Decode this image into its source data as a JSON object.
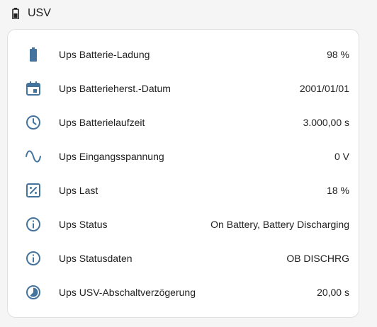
{
  "header": {
    "title": "USV",
    "icon": "battery-icon"
  },
  "accent_color": "#44739e",
  "rows": [
    {
      "label": "Ups Batterie-Ladung",
      "value": "98 %",
      "icon": "battery-full-icon"
    },
    {
      "label": "Ups Batterieherst.-Datum",
      "value": "2001/01/01",
      "icon": "calendar-icon"
    },
    {
      "label": "Ups Batterielaufzeit",
      "value": "3.000,00 s",
      "icon": "clock-icon"
    },
    {
      "label": "Ups Eingangsspannung",
      "value": "0 V",
      "icon": "sine-wave-icon"
    },
    {
      "label": "Ups Last",
      "value": "18 %",
      "icon": "percent-box-icon"
    },
    {
      "label": "Ups Status",
      "value": "On Battery, Battery Discharging",
      "icon": "info-icon"
    },
    {
      "label": "Ups Statusdaten",
      "value": "OB DISCHRG",
      "icon": "info-icon"
    },
    {
      "label": "Ups USV-Abschaltverzögerung",
      "value": "20,00 s",
      "icon": "timer-icon"
    }
  ]
}
